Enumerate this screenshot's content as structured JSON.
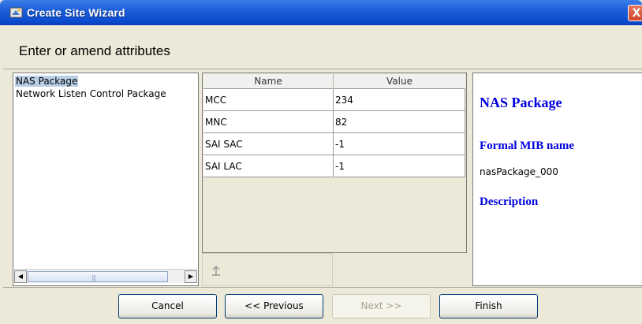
{
  "window": {
    "title": "Create Site Wizard",
    "close_label": "X"
  },
  "header": {
    "title": "Enter or amend attributes"
  },
  "tree": {
    "items": [
      {
        "label": "NAS Package",
        "selected": true
      },
      {
        "label": "Network Listen Control Package",
        "selected": false
      }
    ]
  },
  "table": {
    "columns": [
      "Name",
      "Value"
    ],
    "rows": [
      {
        "name": "MCC",
        "value": "234"
      },
      {
        "name": "MNC",
        "value": "82"
      },
      {
        "name": "SAI SAC",
        "value": "-1"
      },
      {
        "name": "SAI LAC",
        "value": "-1"
      }
    ]
  },
  "description": {
    "title": "NAS Package",
    "formal_mib_label": "Formal MIB name",
    "formal_mib_value": "nasPackage_000",
    "description_label": "Description"
  },
  "buttons": {
    "cancel": "Cancel",
    "previous": "<< Previous",
    "next": "Next >>",
    "finish": "Finish"
  },
  "colors": {
    "titlebar": "#0b4bd0",
    "selection": "#b8cfe5",
    "description_text": "#0000e0",
    "close_button": "#d2462a"
  },
  "icons": {
    "title": "wizard-icon",
    "move_up": "arrow-up-icon",
    "close": "close-icon"
  }
}
